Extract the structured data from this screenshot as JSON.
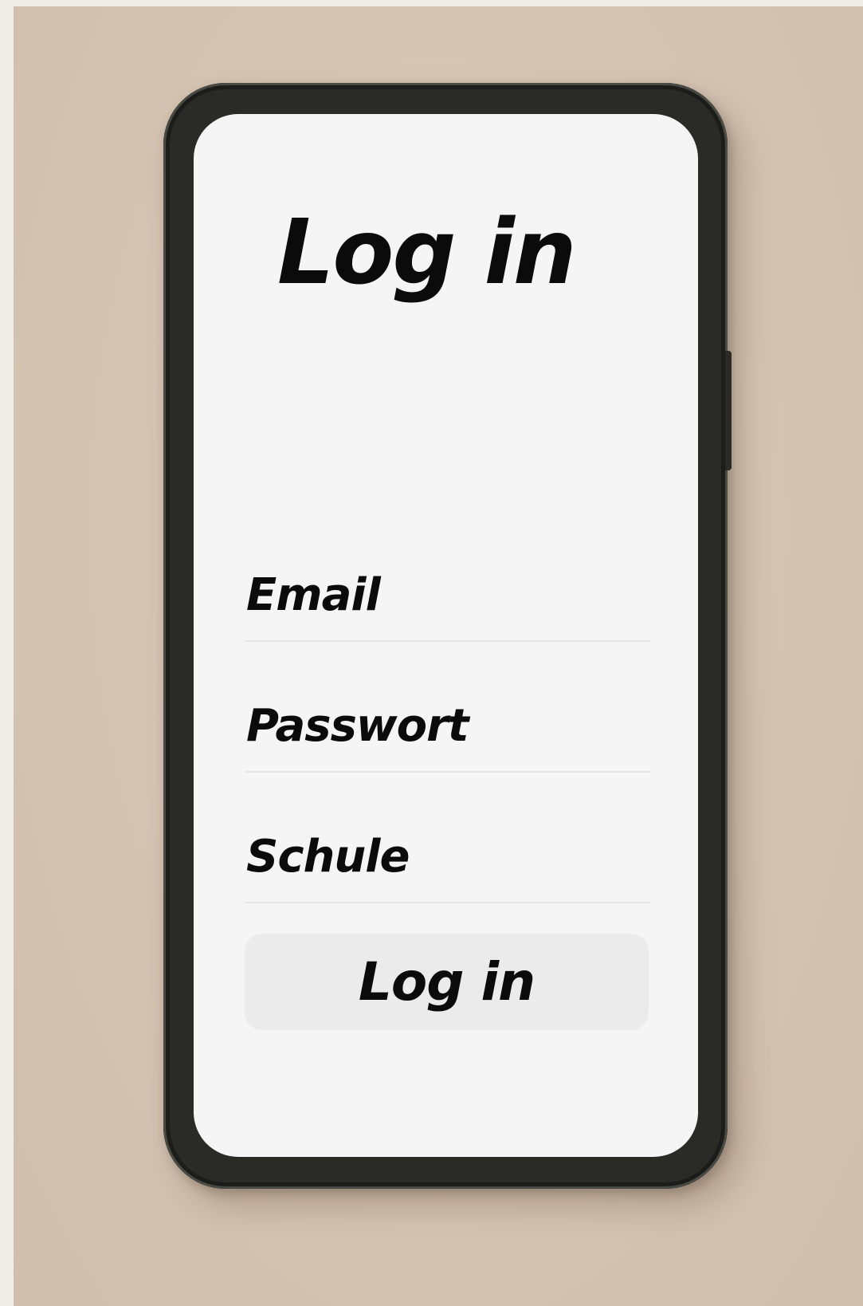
{
  "login": {
    "title": "Log in",
    "fields": [
      {
        "label": "Email",
        "value": "",
        "placeholder": ""
      },
      {
        "label": "Passwort",
        "value": "",
        "placeholder": ""
      },
      {
        "label": "Schule",
        "value": "",
        "placeholder": ""
      }
    ],
    "submit_label": "Log in"
  },
  "colors": {
    "background": "#d6c6b6",
    "phone_frame": "#2a2a26",
    "screen": "#f5f5f5",
    "button": "#ebebeb",
    "text": "#0b0b0b"
  }
}
